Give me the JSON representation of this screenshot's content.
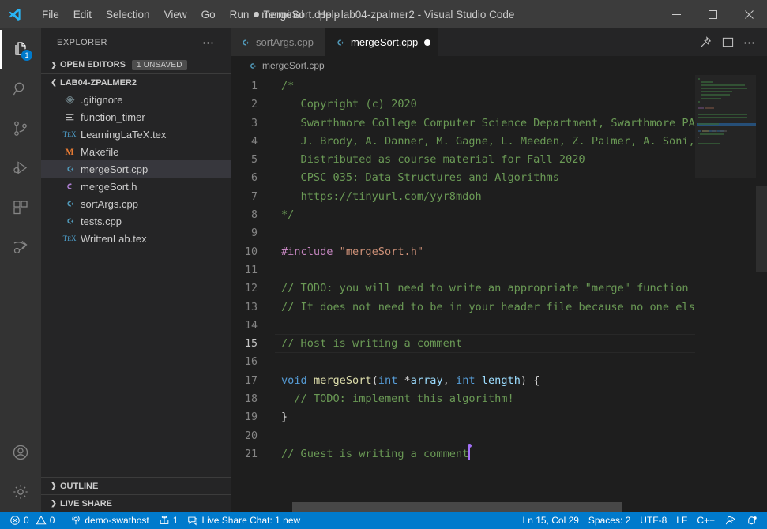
{
  "titlebar": {
    "logo_icon": "vscode-logo-icon",
    "menus": [
      "File",
      "Edit",
      "Selection",
      "View",
      "Go",
      "Run",
      "Terminal",
      "Help"
    ],
    "dirty_dot": "●",
    "title": "mergeSort.cpp - lab04-zpalmer2 - Visual Studio Code",
    "minimize_icon": "minimize-icon",
    "maximize_icon": "maximize-icon",
    "close_icon": "close-icon"
  },
  "activitybar": {
    "items": [
      {
        "name": "explorer",
        "icon": "files-icon",
        "badge": "1",
        "active": true
      },
      {
        "name": "search",
        "icon": "search-icon",
        "badge": "",
        "active": false
      },
      {
        "name": "source-control",
        "icon": "source-control-icon",
        "badge": "",
        "active": false
      },
      {
        "name": "run-debug",
        "icon": "run-and-debug-icon",
        "badge": "",
        "active": false
      },
      {
        "name": "extensions",
        "icon": "extensions-icon",
        "badge": "",
        "active": false
      },
      {
        "name": "live-share",
        "icon": "live-share-icon",
        "badge": "",
        "active": false
      }
    ],
    "bottom": [
      {
        "name": "accounts",
        "icon": "account-icon"
      },
      {
        "name": "settings",
        "icon": "gear-icon"
      }
    ]
  },
  "sidebar": {
    "header": "EXPLORER",
    "more_icon": "ellipsis-icon",
    "open_editors": {
      "label": "OPEN EDITORS",
      "badge": "1 UNSAVED",
      "expanded": false
    },
    "project": {
      "label": "LAB04-ZPALMER2",
      "expanded": true
    },
    "files": [
      {
        "name": ".gitignore",
        "icon": "git-file-icon",
        "color": "#6d8086",
        "selected": false
      },
      {
        "name": "function_timer",
        "icon": "settings-file-icon",
        "color": "#cccccc",
        "selected": false
      },
      {
        "name": "LearningLaTeX.tex",
        "icon": "tex-file-icon",
        "color": "#4fa3d1",
        "selected": false
      },
      {
        "name": "Makefile",
        "icon": "makefile-icon",
        "color": "#e37933",
        "selected": false
      },
      {
        "name": "mergeSort.cpp",
        "icon": "cpp-file-icon",
        "color": "#519aba",
        "selected": true
      },
      {
        "name": "mergeSort.h",
        "icon": "c-header-file-icon",
        "color": "#b180d7",
        "selected": false
      },
      {
        "name": "sortArgs.cpp",
        "icon": "cpp-file-icon",
        "color": "#519aba",
        "selected": false
      },
      {
        "name": "tests.cpp",
        "icon": "cpp-file-icon",
        "color": "#519aba",
        "selected": false
      },
      {
        "name": "WrittenLab.tex",
        "icon": "tex-file-icon",
        "color": "#4fa3d1",
        "selected": false
      }
    ],
    "panels": [
      {
        "label": "OUTLINE",
        "expanded": false
      },
      {
        "label": "LIVE SHARE",
        "expanded": false
      }
    ]
  },
  "editor": {
    "tabs": [
      {
        "label": "sortArgs.cpp",
        "icon": "cpp-file-icon",
        "color": "#519aba",
        "active": false,
        "dirty": false
      },
      {
        "label": "mergeSort.cpp",
        "icon": "cpp-file-icon",
        "color": "#519aba",
        "active": true,
        "dirty": true
      }
    ],
    "actions": [
      {
        "name": "pin-editor",
        "icon": "pin-icon"
      },
      {
        "name": "split-editor",
        "icon": "split-editor-icon"
      },
      {
        "name": "more-actions",
        "icon": "ellipsis-icon"
      }
    ],
    "breadcrumb": {
      "label": "mergeSort.cpp",
      "icon": "cpp-file-icon",
      "color": "#519aba"
    },
    "current_line": 15,
    "lines": [
      {
        "n": 1,
        "tokens": [
          {
            "t": "/*",
            "c": "cmt"
          }
        ]
      },
      {
        "n": 2,
        "tokens": [
          {
            "t": "   Copyright (c) 2020",
            "c": "cmt"
          }
        ]
      },
      {
        "n": 3,
        "tokens": [
          {
            "t": "   Swarthmore College Computer Science Department, Swarthmore PA",
            "c": "cmt"
          }
        ]
      },
      {
        "n": 4,
        "tokens": [
          {
            "t": "   J. Brody, A. Danner, M. Gagne, L. Meeden, Z. Palmer, A. Soni, M.",
            "c": "cmt"
          }
        ]
      },
      {
        "n": 5,
        "tokens": [
          {
            "t": "   Distributed as course material for Fall 2020",
            "c": "cmt"
          }
        ]
      },
      {
        "n": 6,
        "tokens": [
          {
            "t": "   CPSC 035: Data Structures and Algorithms",
            "c": "cmt"
          }
        ]
      },
      {
        "n": 7,
        "tokens": [
          {
            "t": "   ",
            "c": "cmt"
          },
          {
            "t": "https://tinyurl.com/yyr8mdoh",
            "c": "cmt-link"
          }
        ]
      },
      {
        "n": 8,
        "tokens": [
          {
            "t": "*/",
            "c": "cmt"
          }
        ]
      },
      {
        "n": 9,
        "tokens": []
      },
      {
        "n": 10,
        "tokens": [
          {
            "t": "#include",
            "c": "kw2"
          },
          {
            "t": " ",
            "c": "punc"
          },
          {
            "t": "\"mergeSort.h\"",
            "c": "str"
          }
        ]
      },
      {
        "n": 11,
        "tokens": []
      },
      {
        "n": 12,
        "tokens": [
          {
            "t": "// TODO: you will need to write an appropriate \"merge\" function her",
            "c": "cmt"
          }
        ]
      },
      {
        "n": 13,
        "tokens": [
          {
            "t": "// It does not need to be in your header file because no one else w",
            "c": "cmt"
          }
        ]
      },
      {
        "n": 14,
        "tokens": []
      },
      {
        "n": 15,
        "tokens": [
          {
            "t": "// Host is writing a comment",
            "c": "cmt"
          }
        ]
      },
      {
        "n": 16,
        "tokens": []
      },
      {
        "n": 17,
        "tokens": [
          {
            "t": "void",
            "c": "kw"
          },
          {
            "t": " ",
            "c": "punc"
          },
          {
            "t": "mergeSort",
            "c": "fn"
          },
          {
            "t": "(",
            "c": "punc"
          },
          {
            "t": "int",
            "c": "kw"
          },
          {
            "t": " *",
            "c": "punc"
          },
          {
            "t": "array",
            "c": "var"
          },
          {
            "t": ", ",
            "c": "punc"
          },
          {
            "t": "int",
            "c": "kw"
          },
          {
            "t": " ",
            "c": "punc"
          },
          {
            "t": "length",
            "c": "var"
          },
          {
            "t": ") {",
            "c": "punc"
          }
        ]
      },
      {
        "n": 18,
        "tokens": [
          {
            "t": "  // TODO: implement this algorithm!",
            "c": "cmt"
          }
        ]
      },
      {
        "n": 19,
        "tokens": [
          {
            "t": "}",
            "c": "punc"
          }
        ]
      },
      {
        "n": 20,
        "tokens": []
      },
      {
        "n": 21,
        "tokens": [
          {
            "t": "// Guest is writing a comment",
            "c": "cmt"
          }
        ],
        "cursor": true
      }
    ]
  },
  "statusbar": {
    "left": [
      {
        "name": "problems",
        "icon": "error-warning-icon",
        "text": "0  0",
        "errors": "0",
        "warnings": "0"
      },
      {
        "name": "live-share-session",
        "icon": "broadcast-icon",
        "text": "demo-swathost"
      },
      {
        "name": "live-share-participants",
        "icon": "participants-icon",
        "text": "1"
      },
      {
        "name": "live-share-chat",
        "icon": "chat-icon",
        "text": "Live Share Chat: 1 new"
      }
    ],
    "right": [
      {
        "name": "editor-position",
        "text": "Ln 15, Col 29"
      },
      {
        "name": "indentation",
        "text": "Spaces: 2"
      },
      {
        "name": "encoding",
        "text": "UTF-8"
      },
      {
        "name": "eol",
        "text": "LF"
      },
      {
        "name": "language-mode",
        "text": "C++"
      },
      {
        "name": "feedback",
        "icon": "feedback-icon",
        "text": ""
      },
      {
        "name": "notifications",
        "icon": "bell-dot-icon",
        "text": ""
      }
    ]
  }
}
